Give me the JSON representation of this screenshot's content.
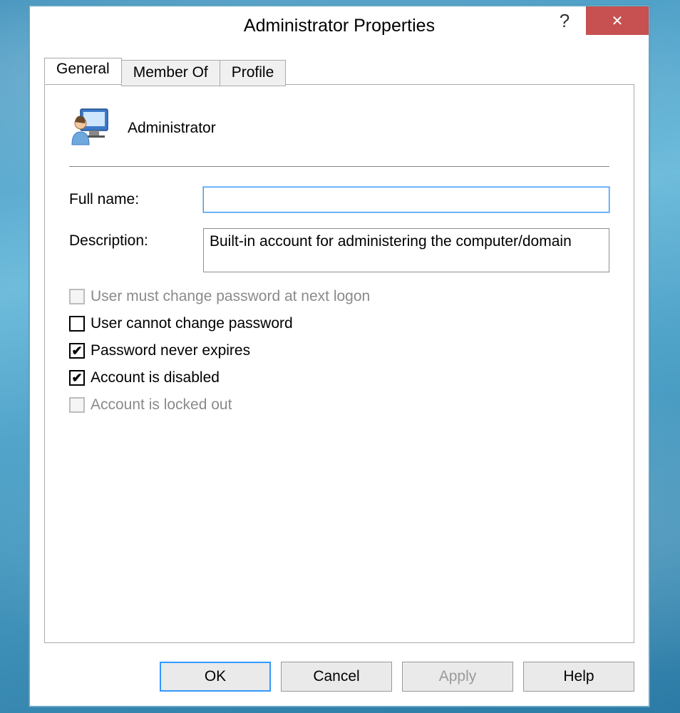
{
  "dialog": {
    "title": "Administrator Properties",
    "help_symbol": "?",
    "close_symbol": "✕"
  },
  "tabs": {
    "general": "General",
    "member_of": "Member Of",
    "profile": "Profile",
    "active": "General"
  },
  "general": {
    "user_name": "Administrator",
    "full_name_label": "Full name:",
    "full_name_value": "",
    "description_label": "Description:",
    "description_value": "Built-in account for administering the computer/domain",
    "checks": {
      "must_change": {
        "label": "User must change password at next logon",
        "checked": false,
        "enabled": false
      },
      "cannot_change": {
        "label": "User cannot change password",
        "checked": false,
        "enabled": true
      },
      "never_expires": {
        "label": "Password never expires",
        "checked": true,
        "enabled": true
      },
      "disabled": {
        "label": "Account is disabled",
        "checked": true,
        "enabled": true
      },
      "locked_out": {
        "label": "Account is locked out",
        "checked": false,
        "enabled": false
      }
    }
  },
  "buttons": {
    "ok": "OK",
    "cancel": "Cancel",
    "apply": "Apply",
    "help": "Help"
  }
}
